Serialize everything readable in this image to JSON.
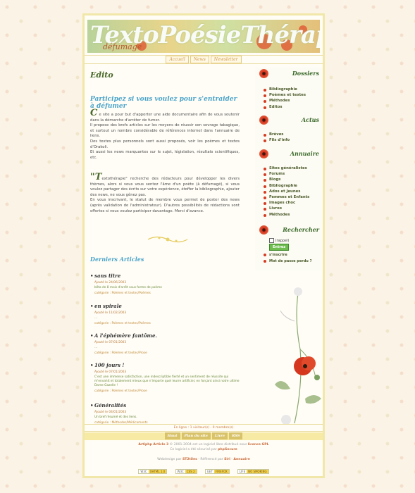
{
  "banner": {
    "title": "TextoPoésieThérapie",
    "subtitle": "défumage"
  },
  "topnav": [
    "Accueil",
    "News",
    "Newsletter"
  ],
  "edito": {
    "title": "Edito",
    "invite": "Participez si vous voulez pour s'entraider à défumer",
    "p1_cap": "C",
    "p1": "e site a pour but d'apporter une aide documentaire afin de vous soutenir dans la démarche d'arrêter de fumer.",
    "p2": "Il propose des brefs articles sur les moyens de réussir son sevrage tabagique, et surtout un nombre considérable de références internet dans l'annuaire de liens.",
    "p3": "Des textes plus personnels sont aussi proposés, voir les poèmes et textes d'Orakoli.",
    "p4": "Et aussi les news marquantes sur le sujet, législation, résultats scientifiques, etc.",
    "p5_cap": "T",
    "p5": "extothérapie\" recherche des rédacteurs pour développer les divers thèmes, alors si vous vous sentez l'âme d'un poète (à défumagé), si vous voulez partager des écrits sur votre expérience, étoffer la bibliographie, ajouter des news, ne vous gênez pas.",
    "p6": "En vous inscrivant, le statut de membre vous permet de poster des news (après validation de l'administrateur). D'autres possibilités de rédactions sont offertes si vous voulez participer davantage. Merci d'avance."
  },
  "articles": {
    "heading": "Derniers Articles",
    "items": [
      {
        "title": "sans titre",
        "date": "Ajouté le 24/06/2003",
        "summary": "bêta de 8 mois d'arrêt sous forme de poème",
        "category": "catégorie : Poèmes et textes/Poèmes"
      },
      {
        "title": "en spirale",
        "date": "Ajouté le 11/02/2003",
        "summary": "...",
        "category": "catégorie : Poèmes et textes/Poèmes"
      },
      {
        "title": "A l'éphémère fantôme.",
        "date": "Ajouté le 07/01/2003",
        "summary": "...",
        "category": "catégorie : Poèmes et textes/Prose"
      },
      {
        "title": "100 jours !",
        "date": "Ajouté le 07/01/2003",
        "summary": "C'est une immense satisfaction, une indescriptible fierté et un sentiment de réussite qui m'envahit et totalement mieux que n'importe quel leurre artificiel, en forçant ainsi notre ultime Dame Gazelle !",
        "category": "catégorie : Poèmes et textes/Prose"
      },
      {
        "title": "Généralités",
        "date": "Ajouté le 04/01/2003",
        "summary": "Un bref résumé et des liens.",
        "category": "catégorie : Méthodes/Médicaments"
      }
    ]
  },
  "sidebar": {
    "dossiers": {
      "title": "Dossiers",
      "links": [
        "Bibliographie",
        "Poèmes et textes",
        "Méthodes",
        "Editos"
      ]
    },
    "actus": {
      "title": "Actus",
      "links": [
        "Brèves",
        "Fils d'info"
      ]
    },
    "annuaire": {
      "title": "Annuaire",
      "links": [
        "Sites généralistes",
        "Forums",
        "Blogs",
        "Bibliographie",
        "Ados et Jeunes",
        "Femmes et Enfants",
        "Images choc",
        "Livres",
        "Méthodes"
      ]
    },
    "rechercher": {
      "title": "Rechercher",
      "remember": "(rappel)",
      "button": "Entrez",
      "links": [
        "s'inscrire",
        "Mot de passe perdu ?"
      ]
    }
  },
  "footer": {
    "online": "En ligne : 1 visiteur(s) - 0 membre(s)",
    "nav": [
      "Haut",
      "Plan du site",
      "Livre",
      "RSS"
    ],
    "line1_a": "Artiphp Article 3",
    "line1_b": " © 2001-2004 est un logiciel libre distribué sous ",
    "line1_c": "licence GPL",
    "line2_a": "Ce logiciel a été sécurisé par ",
    "line2_b": "phpSecure",
    "line3_a": "Webdesign par ",
    "line3_b": "ST2tiles",
    "line3_c": " - Référencé par ",
    "line3_d": "Siri",
    "line3_e": " - ",
    "line3_f": "Annuaire",
    "badges": [
      {
        "k": "W3C",
        "v": "XHTML 1.0"
      },
      {
        "k": "W3C",
        "v": "CSS 2"
      },
      {
        "k": "GET",
        "v": "FIREFOX"
      },
      {
        "k": "LIFE",
        "v": "NO SMOKING"
      }
    ]
  }
}
